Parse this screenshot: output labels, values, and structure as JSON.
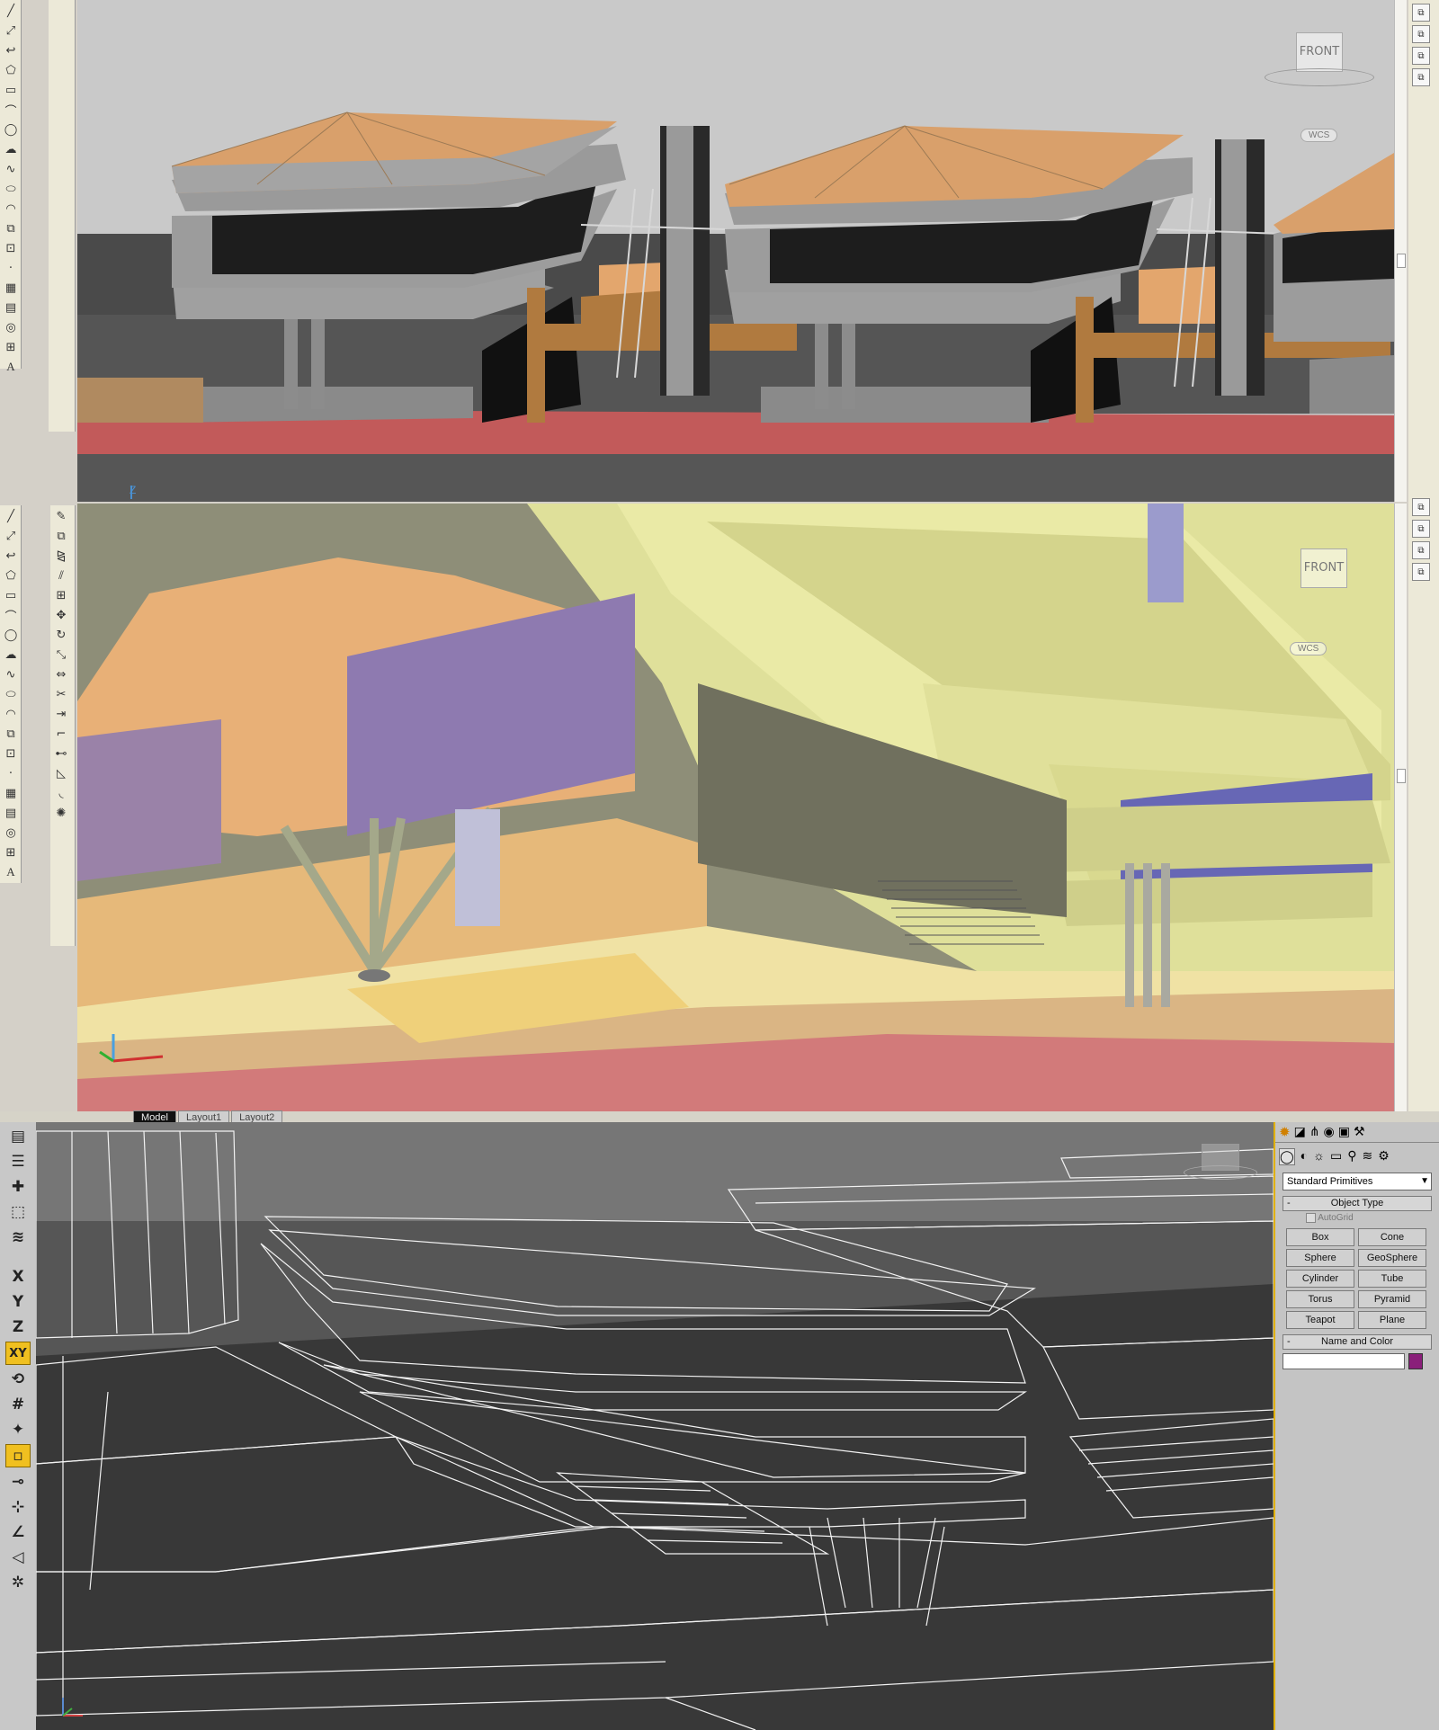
{
  "autocad": {
    "top_viewport": {
      "viewcube_label": "FRONT",
      "wcs_label": "WCS",
      "ucs_axis_label": "Z"
    },
    "mid_viewport": {
      "viewcube_label": "FRONT",
      "wcs_label": "WCS"
    },
    "layout_tabs": [
      "Model",
      "Layout1",
      "Layout2"
    ],
    "draw_tools": [
      "line-icon",
      "construction-line-icon",
      "polyline-icon",
      "polygon-icon",
      "rectangle-icon",
      "arc-icon",
      "circle-icon",
      "revision-cloud-icon",
      "spline-icon",
      "ellipse-icon",
      "ellipse-arc-icon",
      "insert-block-icon",
      "make-block-icon",
      "point-icon",
      "hatch-icon",
      "gradient-icon",
      "region-icon",
      "table-icon",
      "mtext-icon"
    ],
    "draw_text_glyph": "A"
  },
  "max": {
    "axis_buttons": [
      "X",
      "Y",
      "Z",
      "XY"
    ],
    "command_panel": {
      "dropdown_value": "Standard Primitives",
      "object_type": {
        "title": "Object Type",
        "autogrid_label": "AutoGrid",
        "buttons": [
          "Box",
          "Cone",
          "Sphere",
          "GeoSphere",
          "Cylinder",
          "Tube",
          "Torus",
          "Pyramid",
          "Teapot",
          "Plane"
        ]
      },
      "name_and_color": {
        "title": "Name and Color",
        "name_value": "",
        "swatch_color": "#8a1f7a"
      }
    }
  },
  "colors": {
    "accent_yellow": "#f0c020",
    "max_bg": "#3a3a3a",
    "acad_grey": "#c8c8c8"
  }
}
